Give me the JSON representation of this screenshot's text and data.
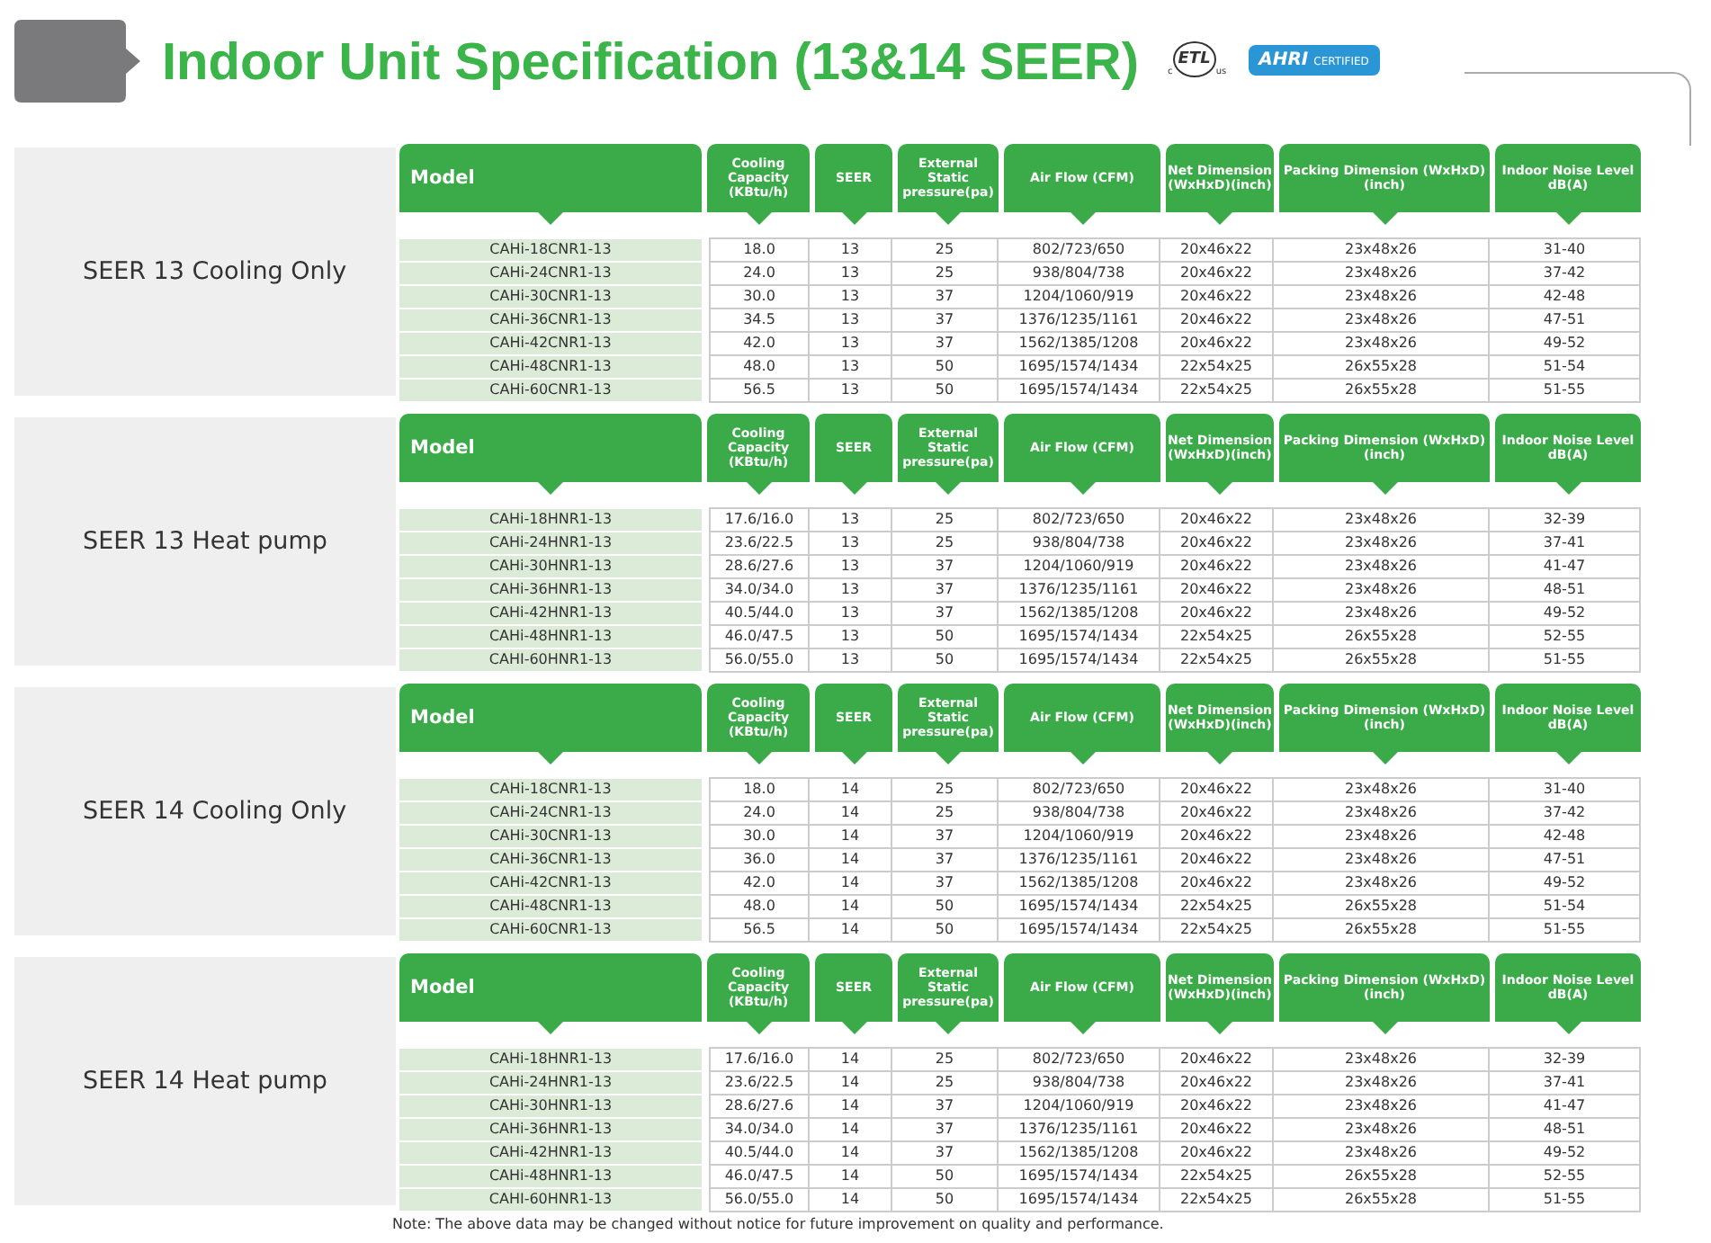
{
  "title": "Indoor Unit Specification (13&14 SEER)",
  "logos": {
    "etl": "ETL",
    "etl_left": "c",
    "etl_right": "us",
    "ahri": "AHRI",
    "ahri_sub": "CERTIFIED"
  },
  "sections": [
    {
      "label": "SEER 13 Cooling Only",
      "columns": [
        "Model",
        "Cooling Capacity (KBtu/h)",
        "SEER",
        "External Static pressure(pa)",
        "Air Flow (CFM)",
        "Net Dimension (WxHxD)(inch)",
        "Packing Dimension (WxHxD)(inch)",
        "Indoor Noise Level dB(A)"
      ],
      "rows": [
        [
          "CAHi-18CNR1-13",
          "18.0",
          "13",
          "25",
          "802/723/650",
          "20x46x22",
          "23x48x26",
          "31-40"
        ],
        [
          "CAHi-24CNR1-13",
          "24.0",
          "13",
          "25",
          "938/804/738",
          "20x46x22",
          "23x48x26",
          "37-42"
        ],
        [
          "CAHi-30CNR1-13",
          "30.0",
          "13",
          "37",
          "1204/1060/919",
          "20x46x22",
          "23x48x26",
          "42-48"
        ],
        [
          "CAHi-36CNR1-13",
          "34.5",
          "13",
          "37",
          "1376/1235/1161",
          "20x46x22",
          "23x48x26",
          "47-51"
        ],
        [
          "CAHi-42CNR1-13",
          "42.0",
          "13",
          "37",
          "1562/1385/1208",
          "20x46x22",
          "23x48x26",
          "49-52"
        ],
        [
          "CAHi-48CNR1-13",
          "48.0",
          "13",
          "50",
          "1695/1574/1434",
          "22x54x25",
          "26x55x28",
          "51-54"
        ],
        [
          "CAHi-60CNR1-13",
          "56.5",
          "13",
          "50",
          "1695/1574/1434",
          "22x54x25",
          "26x55x28",
          "51-55"
        ]
      ]
    },
    {
      "label": "SEER 13 Heat pump",
      "columns": [
        "Model",
        "Cooling Capacity (KBtu/h)",
        "SEER",
        "External Static pressure(pa)",
        "Air Flow (CFM)",
        "Net Dimension (WxHxD)(inch)",
        "Packing Dimension (WxHxD)(inch)",
        "Indoor Noise Level dB(A)"
      ],
      "rows": [
        [
          "CAHi-18HNR1-13",
          "17.6/16.0",
          "13",
          "25",
          "802/723/650",
          "20x46x22",
          "23x48x26",
          "32-39"
        ],
        [
          "CAHi-24HNR1-13",
          "23.6/22.5",
          "13",
          "25",
          "938/804/738",
          "20x46x22",
          "23x48x26",
          "37-41"
        ],
        [
          "CAHi-30HNR1-13",
          "28.6/27.6",
          "13",
          "37",
          "1204/1060/919",
          "20x46x22",
          "23x48x26",
          "41-47"
        ],
        [
          "CAHi-36HNR1-13",
          "34.0/34.0",
          "13",
          "37",
          "1376/1235/1161",
          "20x46x22",
          "23x48x26",
          "48-51"
        ],
        [
          "CAHi-42HNR1-13",
          "40.5/44.0",
          "13",
          "37",
          "1562/1385/1208",
          "20x46x22",
          "23x48x26",
          "49-52"
        ],
        [
          "CAHi-48HNR1-13",
          "46.0/47.5",
          "13",
          "50",
          "1695/1574/1434",
          "22x54x25",
          "26x55x28",
          "52-55"
        ],
        [
          "CAHI-60HNR1-13",
          "56.0/55.0",
          "13",
          "50",
          "1695/1574/1434",
          "22x54x25",
          "26x55x28",
          "51-55"
        ]
      ]
    },
    {
      "label": "SEER 14 Cooling Only",
      "columns": [
        "Model",
        "Cooling Capacity (KBtu/h)",
        "SEER",
        "External Static pressure(pa)",
        "Air Flow (CFM)",
        "Net Dimension (WxHxD)(inch)",
        "Packing Dimension (WxHxD)(inch)",
        "Indoor Noise Level dB(A)"
      ],
      "rows": [
        [
          "CAHi-18CNR1-13",
          "18.0",
          "14",
          "25",
          "802/723/650",
          "20x46x22",
          "23x48x26",
          "31-40"
        ],
        [
          "CAHi-24CNR1-13",
          "24.0",
          "14",
          "25",
          "938/804/738",
          "20x46x22",
          "23x48x26",
          "37-42"
        ],
        [
          "CAHi-30CNR1-13",
          "30.0",
          "14",
          "37",
          "1204/1060/919",
          "20x46x22",
          "23x48x26",
          "42-48"
        ],
        [
          "CAHi-36CNR1-13",
          "36.0",
          "14",
          "37",
          "1376/1235/1161",
          "20x46x22",
          "23x48x26",
          "47-51"
        ],
        [
          "CAHi-42CNR1-13",
          "42.0",
          "14",
          "37",
          "1562/1385/1208",
          "20x46x22",
          "23x48x26",
          "49-52"
        ],
        [
          "CAHi-48CNR1-13",
          "48.0",
          "14",
          "50",
          "1695/1574/1434",
          "22x54x25",
          "26x55x28",
          "51-54"
        ],
        [
          "CAHi-60CNR1-13",
          "56.5",
          "14",
          "50",
          "1695/1574/1434",
          "22x54x25",
          "26x55x28",
          "51-55"
        ]
      ]
    },
    {
      "label": "SEER 14 Heat pump",
      "columns": [
        "Model",
        "Cooling Capacity (KBtu/h)",
        "SEER",
        "External Static pressure(pa)",
        "Air Flow (CFM)",
        "Net Dimension (WxHxD)(inch)",
        "Packing Dimension (WxHxD)(inch)",
        "Indoor Noise Level dB(A)"
      ],
      "rows": [
        [
          "CAHi-18HNR1-13",
          "17.6/16.0",
          "14",
          "25",
          "802/723/650",
          "20x46x22",
          "23x48x26",
          "32-39"
        ],
        [
          "CAHi-24HNR1-13",
          "23.6/22.5",
          "14",
          "25",
          "938/804/738",
          "20x46x22",
          "23x48x26",
          "37-41"
        ],
        [
          "CAHi-30HNR1-13",
          "28.6/27.6",
          "14",
          "37",
          "1204/1060/919",
          "20x46x22",
          "23x48x26",
          "41-47"
        ],
        [
          "CAHi-36HNR1-13",
          "34.0/34.0",
          "14",
          "37",
          "1376/1235/1161",
          "20x46x22",
          "23x48x26",
          "48-51"
        ],
        [
          "CAHi-42HNR1-13",
          "40.5/44.0",
          "14",
          "37",
          "1562/1385/1208",
          "20x46x22",
          "23x48x26",
          "49-52"
        ],
        [
          "CAHi-48HNR1-13",
          "46.0/47.5",
          "14",
          "50",
          "1695/1574/1434",
          "22x54x25",
          "26x55x28",
          "52-55"
        ],
        [
          "CAHI-60HNR1-13",
          "56.0/55.0",
          "14",
          "50",
          "1695/1574/1434",
          "22x54x25",
          "26x55x28",
          "51-55"
        ]
      ]
    }
  ],
  "note": "Note: The above data may be changed without notice for future improvement on quality and performance."
}
